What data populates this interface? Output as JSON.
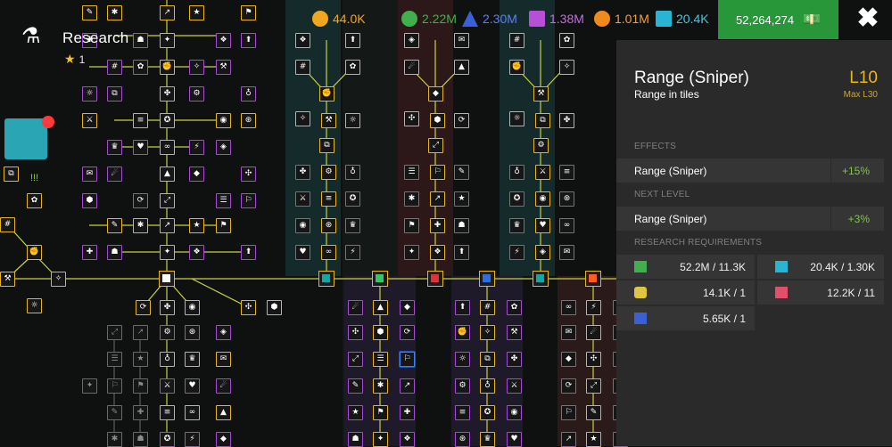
{
  "header": {
    "title": "Research",
    "stars": "1",
    "resources": [
      {
        "id": "research-points",
        "value": "44.0K",
        "color": "#f0a61e",
        "icon": "pentagon-icon"
      },
      {
        "id": "green-currency",
        "value": "2.22M",
        "color": "#3fb04c",
        "icon": "striped-circle-icon"
      },
      {
        "id": "blue-currency",
        "value": "2.30M",
        "color": "#3a60d8",
        "icon": "triangle-stripes-icon"
      },
      {
        "id": "purple-currency",
        "value": "1.38M",
        "color": "#b84fd8",
        "icon": "stripes-square-icon"
      },
      {
        "id": "orange-currency",
        "value": "1.01M",
        "color": "#f08a1e",
        "icon": "orange-circle-icon"
      },
      {
        "id": "cyan-currency",
        "value": "20.4K",
        "color": "#28b5d4",
        "icon": "cyan-bars-icon"
      }
    ],
    "cash": "52,264,274"
  },
  "sidebar": {
    "status": "!!!"
  },
  "panel": {
    "title": "Range (Sniper)",
    "level": "L10",
    "subtitle": "Range in tiles",
    "max_level": "Max L30",
    "effects_label": "EFFECTS",
    "effect": {
      "name": "Range (Sniper)",
      "value": "+15%"
    },
    "next_label": "NEXT LEVEL",
    "next": {
      "name": "Range (Sniper)",
      "value": "+3%"
    },
    "req_label": "RESEARCH REQUIREMENTS",
    "requirements": [
      {
        "value": "52.2M / 11.3K",
        "color": "#3fb04c",
        "icon": "green-cash-icon"
      },
      {
        "value": "20.4K / 1.30K",
        "color": "#28b5d4",
        "icon": "cyan-bars-icon"
      },
      {
        "value": "14.1K / 1",
        "color": "#e0c640",
        "icon": "bullet-icon"
      },
      {
        "value": "12.2K / 11",
        "color": "#e0506a",
        "icon": "pink-square-icon"
      },
      {
        "value": "5.65K / 1",
        "color": "#3a60d8",
        "icon": "blue-star-icon"
      }
    ]
  },
  "tree_glyphs": [
    "✎",
    "✱",
    "↗",
    "★",
    "⚑",
    "✚",
    "☗",
    "✦",
    "❖",
    "⬆",
    "#",
    "✿",
    "✊",
    "✧",
    "⚒",
    "☼",
    "⧉",
    "✤",
    "⚙",
    "♁",
    "⚔",
    "≡",
    "✪",
    "◉",
    "⊛",
    "♛",
    "♥",
    "∞",
    "⚡",
    "◈",
    "✉",
    "☄",
    "▲",
    "◆",
    "✣",
    "⬢",
    "⟳",
    "⤢",
    "☰",
    "⚐"
  ]
}
